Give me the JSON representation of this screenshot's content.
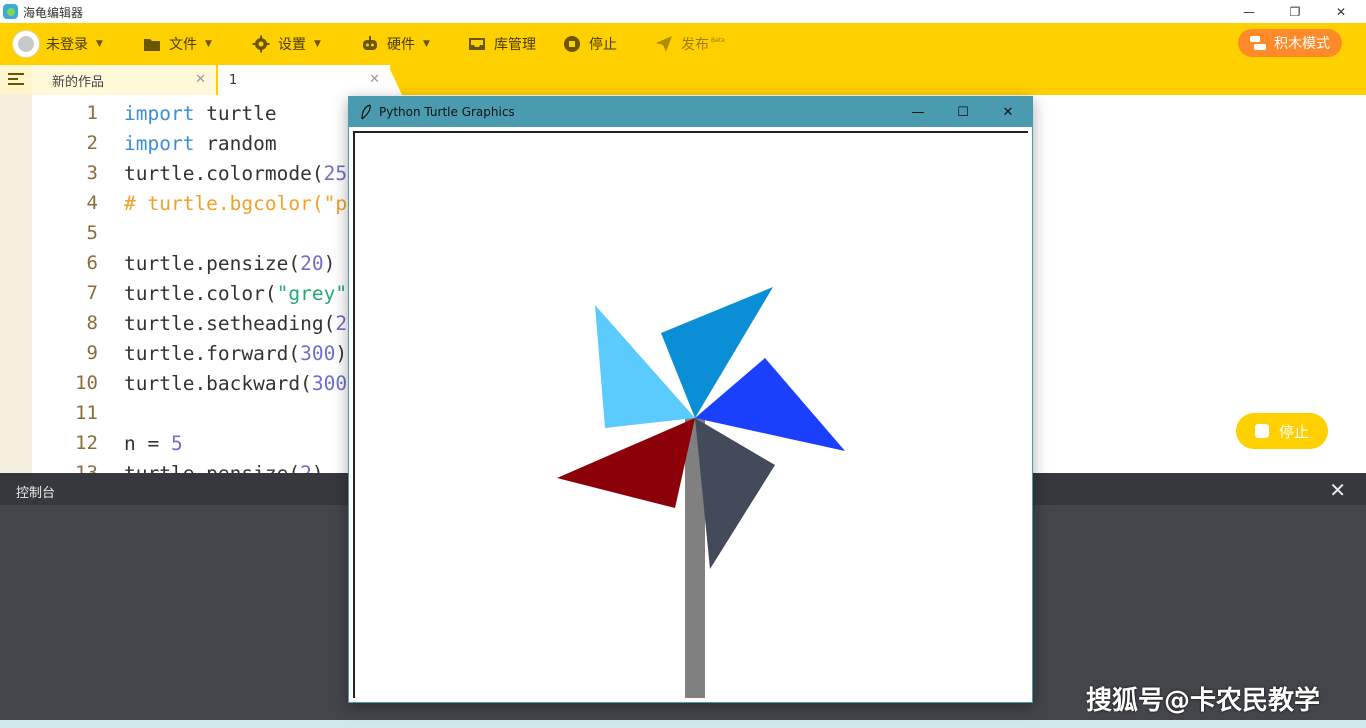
{
  "window": {
    "app_title": "海龟编辑器",
    "minimize": "—",
    "restore": "❐",
    "close": "✕"
  },
  "toolbar": {
    "login_label": "未登录",
    "file_label": "文件",
    "settings_label": "设置",
    "hardware_label": "硬件",
    "library_label": "库管理",
    "stop_label": "停止",
    "publish_label": "发布",
    "publish_beta": "Beta",
    "block_mode_label": "积木模式"
  },
  "tabs": [
    {
      "label": "新的作品",
      "close": "✕",
      "active": false
    },
    {
      "label": "1",
      "close": "✕",
      "active": true
    }
  ],
  "editor": {
    "line_numbers": [
      "1",
      "2",
      "3",
      "4",
      "5",
      "6",
      "7",
      "8",
      "9",
      "10",
      "11",
      "12",
      "13"
    ],
    "lines": [
      {
        "k": "import",
        "r": " turtle"
      },
      {
        "k": "import",
        "r": " random"
      },
      {
        "a": "turtle.colormode(",
        "n": "25"
      },
      {
        "c": "# turtle.bgcolor(\"p"
      },
      {},
      {
        "a": "turtle.pensize(",
        "n": "20",
        "b": ")"
      },
      {
        "a": "turtle.color(",
        "s": "\"grey\""
      },
      {
        "a": "turtle.setheading(",
        "n": "2"
      },
      {
        "a": "turtle.forward(",
        "n": "300",
        "b": ")"
      },
      {
        "a": "turtle.backward(",
        "n": "300"
      },
      {},
      {
        "a": "n = ",
        "n": "5"
      },
      {
        "a": "turtle.pensize(",
        "n": "2",
        "b": ")"
      }
    ]
  },
  "floating_stop_label": "停止",
  "console": {
    "title": "控制台",
    "close": "✕"
  },
  "turtle_window": {
    "title": "Python Turtle Graphics",
    "minimize": "—",
    "maximize": "☐",
    "close": "✕"
  },
  "drawing": {
    "stem_color": "#808080",
    "blades": [
      {
        "color": "#5bcbfd"
      },
      {
        "color": "#0a8fd6"
      },
      {
        "color": "#1a3ffd"
      },
      {
        "color": "#434a5a"
      },
      {
        "color": "#8b0009"
      }
    ]
  },
  "watermark": "搜狐号@卡农民教学",
  "colors": {
    "toolbar_bg": "#ffd000",
    "block_mode_bg": "#ff8a2a",
    "console_bg": "#43454b",
    "turtle_titlebar": "#4a9bb0"
  }
}
